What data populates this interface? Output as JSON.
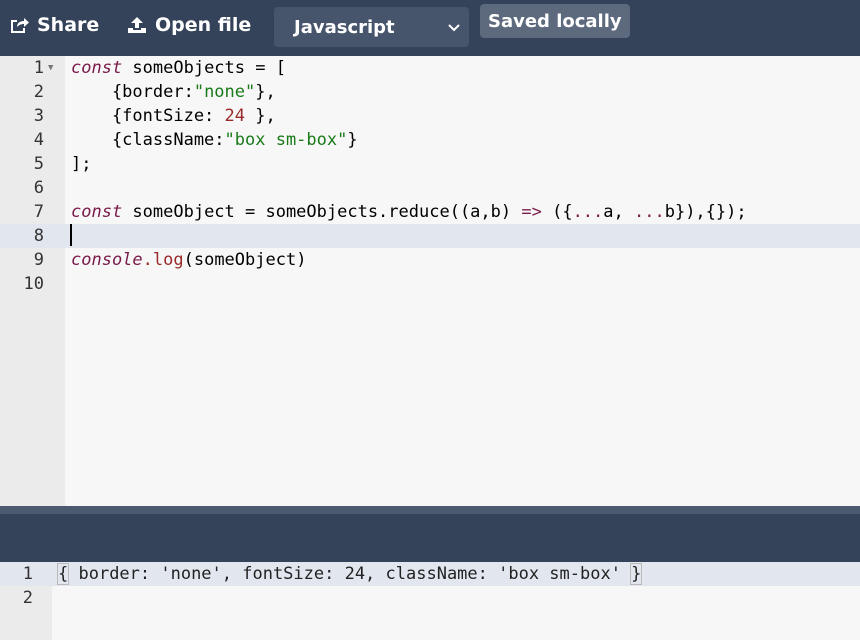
{
  "toolbar": {
    "share_label": "Share",
    "open_label": "Open file",
    "language": "Javascript",
    "saved_label": "Saved locally",
    "icons": [
      "share-icon",
      "upload-icon",
      "chevron-down-icon"
    ]
  },
  "editor": {
    "line_numbers": [
      "1",
      "2",
      "3",
      "4",
      "5",
      "6",
      "7",
      "8",
      "9",
      "10"
    ],
    "tokens": {
      "l1": [
        "const",
        " someObjects = ["
      ],
      "l2": [
        "    {border:",
        "\"none\"",
        "},"
      ],
      "l3": [
        "    {fontSize: ",
        "24",
        " },"
      ],
      "l4": [
        "    {className:",
        "\"box sm-box\"",
        "}"
      ],
      "l5": [
        "];"
      ],
      "l7": [
        "const",
        " someObject = someObjects.reduce((a,b) ",
        "=>",
        " ({",
        "...",
        "a, ",
        "...",
        "b}),{});"
      ],
      "l9": [
        "console",
        ".log",
        "(someObject)"
      ]
    },
    "active_line": "8"
  },
  "output": {
    "line_numbers": [
      "1",
      "2"
    ],
    "parts": [
      "{",
      " border: 'none', fontSize: 24, className: 'box sm-box' ",
      "}"
    ]
  }
}
